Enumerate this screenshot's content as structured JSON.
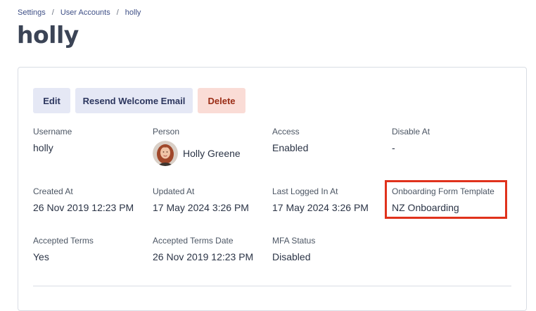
{
  "breadcrumb": {
    "items": [
      {
        "label": "Settings"
      },
      {
        "label": "User Accounts"
      },
      {
        "label": "holly"
      }
    ],
    "separator": "/"
  },
  "page_title": "holly",
  "actions": {
    "edit_label": "Edit",
    "resend_label": "Resend Welcome Email",
    "delete_label": "Delete"
  },
  "details": {
    "username": {
      "label": "Username",
      "value": "holly"
    },
    "person": {
      "label": "Person",
      "value": "Holly Greene"
    },
    "access": {
      "label": "Access",
      "value": "Enabled"
    },
    "disable_at": {
      "label": "Disable At",
      "value": "-"
    },
    "created_at": {
      "label": "Created At",
      "value": "26 Nov 2019 12:23 PM"
    },
    "updated_at": {
      "label": "Updated At",
      "value": "17 May 2024 3:26 PM"
    },
    "last_logged_in": {
      "label": "Last Logged In At",
      "value": "17 May 2024 3:26 PM"
    },
    "onboarding_template": {
      "label": "Onboarding Form Template",
      "value": "NZ Onboarding"
    },
    "accepted_terms": {
      "label": "Accepted Terms",
      "value": "Yes"
    },
    "accepted_terms_date": {
      "label": "Accepted Terms Date",
      "value": "26 Nov 2019 12:23 PM"
    },
    "mfa_status": {
      "label": "MFA Status",
      "value": "Disabled"
    }
  },
  "colors": {
    "highlight": "#e0321c",
    "primary_button_bg": "#e5e8f5",
    "danger_button_bg": "#fadcd6",
    "danger_text": "#9a2c15"
  }
}
